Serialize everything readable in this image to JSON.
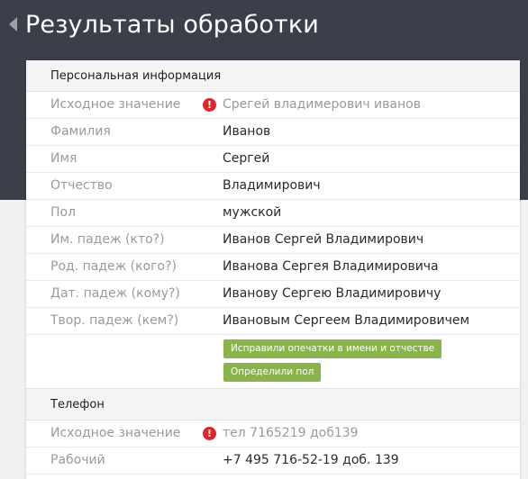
{
  "page": {
    "title": "Результаты обработки"
  },
  "personal": {
    "header": "Персональная информация",
    "rows": [
      {
        "label": "Исходное значение",
        "value": "Срегей владимерович иванов",
        "warning": true
      },
      {
        "label": "Фамилия",
        "value": "Иванов"
      },
      {
        "label": "Имя",
        "value": "Сергей"
      },
      {
        "label": "Отчество",
        "value": "Владимирович"
      },
      {
        "label": "Пол",
        "value": "мужской"
      },
      {
        "label": "Им. падеж (кто?)",
        "value": "Иванов Сергей Владимирович"
      },
      {
        "label": "Род. падеж (кого?)",
        "value": "Иванова Сергея Владимировича"
      },
      {
        "label": "Дат. падеж (кому?)",
        "value": "Иванову Сергею Владимировичу"
      },
      {
        "label": "Твор. падеж (кем?)",
        "value": "Ивановым Сергеем Владимировичем"
      }
    ],
    "badges": [
      "Исправили опечатки в имени и отчестве",
      "Определили пол"
    ]
  },
  "phone": {
    "header": "Телефон",
    "rows": [
      {
        "label": "Исходное значение",
        "value": "тел 7165219 доб139",
        "warning": true
      },
      {
        "label": "Рабочий",
        "value": "+7 495 716-52-19 доб. 139"
      }
    ]
  },
  "icons": {
    "warning": "exclamation-circle-icon",
    "back": "back-arrow-icon"
  },
  "colors": {
    "accent_green": "#8bb34c",
    "warning_red": "#e0242c",
    "header_dark": "#3b3f4a"
  }
}
